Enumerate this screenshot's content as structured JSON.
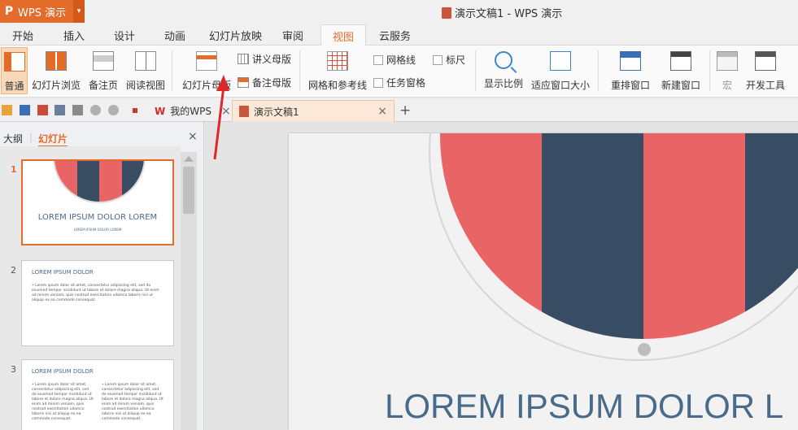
{
  "app": {
    "logo": "P",
    "name": "WPS 演示",
    "arrow": "▾"
  },
  "window": {
    "title": "演示文稿1 - WPS 演示"
  },
  "menu": {
    "tabs": [
      "开始",
      "插入",
      "设计",
      "动画",
      "幻灯片放映",
      "审阅",
      "视图",
      "云服务"
    ],
    "active": "视图"
  },
  "ribbon": {
    "view_buttons": [
      "普通",
      "幻灯片浏览",
      "备注页",
      "阅读视图"
    ],
    "master_button": "幻灯片母版",
    "handout_master": "讲义母版",
    "notes_master": "备注母版",
    "grid_guides": "网格和参考线",
    "gridlines": "网格线",
    "ruler": "标尺",
    "task_pane": "任务窗格",
    "zoom": "显示比例",
    "fit_window": "适应窗口大小",
    "arrange_window": "重排窗口",
    "new_window": "新建窗口",
    "macro": "宏",
    "developer": "开发工具"
  },
  "doc_tabs": [
    {
      "label": "我的WPS",
      "active": false
    },
    {
      "label": "演示文稿1",
      "active": true
    }
  ],
  "left_panel": {
    "tab_outline": "大纲",
    "tab_slides": "幻灯片",
    "close": "×"
  },
  "thumbnails": [
    {
      "number": "1",
      "title": "LOREM IPSUM DOLOR LOREM",
      "subtitle": "LOREM IPSUM DOLOR LOREM"
    },
    {
      "number": "2",
      "heading": "LOREM IPSUM DOLOR",
      "body": "• Lorem ipsum dolor sit amet, consectetur adipiscing elit, sed do eiusmod tempor incididunt ut labore et dolore magna aliqua. Ut enim ad minim veniam, quis nostrud exercitation ullamco laboris nisi ut aliquip ex ea commodo consequat."
    },
    {
      "number": "3",
      "heading": "LOREM IPSUM DOLOR",
      "col1": "• Lorem ipsum dolor sit amet, consectetur adipiscing elit, sed do eiusmod tempor incididunt ut labore et dolore magna aliqua. Ut enim ad minim veniam, quis nostrud exercitation ullamco laboris nisi ut aliquip ex ea commodo consequat.",
      "col2": "• Lorem ipsum dolor sit amet, consectetur adipiscing elit, sed do eiusmod tempor incididunt ut labore et dolore magna aliqua. Ut enim ad minim veniam, quis nostrud exercitation ullamco laboris nisi ut aliquip ex ea commodo consequat."
    }
  ],
  "slide": {
    "title": "LOREM IPSUM DOLOR L"
  },
  "colors": {
    "accent": "#e46c2b",
    "red": "#e96565",
    "navy": "#384d63",
    "title_text": "#4a6a8a",
    "annotation": "#e0262b"
  }
}
